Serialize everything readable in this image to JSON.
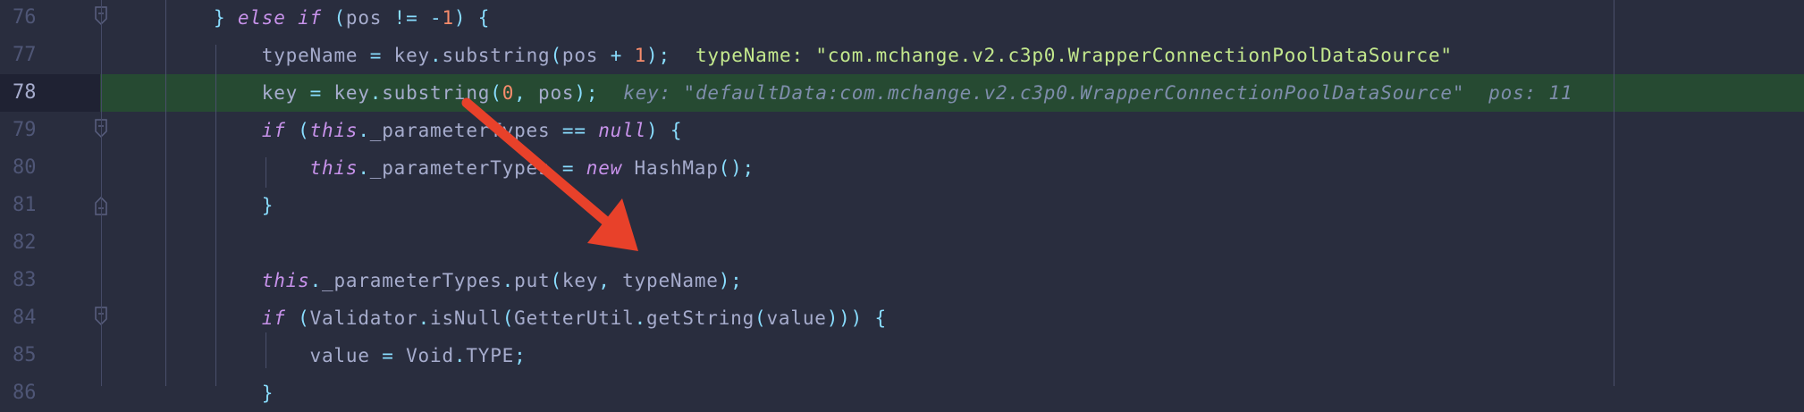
{
  "editor": {
    "theme_colors": {
      "background": "#292d3e",
      "current_line": "#264a32",
      "keyword": "#c792ea",
      "punctuation": "#89ddff",
      "number": "#f78c6c",
      "string": "#c3e88d",
      "text": "#a6accd",
      "annotation_arrow": "#e8412a"
    },
    "current_line": 78,
    "lines": [
      {
        "number": "76",
        "indent": "",
        "fold": "fold-open-icon",
        "tokens": [
          [
            "} ",
            "p"
          ],
          [
            "else if",
            "kw"
          ],
          [
            " (",
            "p"
          ],
          [
            "pos ",
            ""
          ],
          [
            "!= -",
            "p"
          ],
          [
            "1",
            "num"
          ],
          [
            ") {",
            "p"
          ]
        ]
      },
      {
        "number": "77",
        "indent": "    ",
        "tokens": [
          [
            "typeName ",
            ""
          ],
          [
            "= ",
            "p"
          ],
          [
            "key",
            ""
          ],
          [
            ".",
            "p"
          ],
          [
            "substring",
            ""
          ],
          [
            "(",
            "p"
          ],
          [
            "pos ",
            ""
          ],
          [
            "+ ",
            "p"
          ],
          [
            "1",
            "num"
          ],
          [
            ");",
            "p"
          ]
        ],
        "hint": "typeName: \"com.mchange.v2.c3p0.WrapperConnectionPoolDataSource\"",
        "hint_style": "str"
      },
      {
        "number": "78",
        "indent": "    ",
        "tokens": [
          [
            "key ",
            ""
          ],
          [
            "= ",
            "p"
          ],
          [
            "key",
            ""
          ],
          [
            ".",
            "p"
          ],
          [
            "substring",
            ""
          ],
          [
            "(",
            "p"
          ],
          [
            "0",
            "num"
          ],
          [
            ", ",
            "p"
          ],
          [
            "pos",
            ""
          ],
          [
            ");",
            "p"
          ]
        ],
        "hint": "key: \"defaultData:com.mchange.v2.c3p0.WrapperConnectionPoolDataSource\"  pos: 11",
        "hint_style": "gray"
      },
      {
        "number": "79",
        "indent": "    ",
        "fold": "fold-open-icon",
        "tokens": [
          [
            "if",
            "kw"
          ],
          [
            " (",
            "p"
          ],
          [
            "this",
            "this"
          ],
          [
            ".",
            "p"
          ],
          [
            "_parameterTypes ",
            ""
          ],
          [
            "== ",
            "p"
          ],
          [
            "null",
            "kw"
          ],
          [
            ") {",
            "p"
          ]
        ]
      },
      {
        "number": "80",
        "indent": "        ",
        "tokens": [
          [
            "this",
            "this"
          ],
          [
            ".",
            "p"
          ],
          [
            "_parameterTypes ",
            ""
          ],
          [
            "= ",
            "p"
          ],
          [
            "new",
            "kw"
          ],
          [
            " HashMap",
            ""
          ],
          [
            "();",
            "p"
          ]
        ]
      },
      {
        "number": "81",
        "indent": "    ",
        "fold": "fold-close-icon",
        "tokens": [
          [
            "}",
            "p"
          ]
        ]
      },
      {
        "number": "82",
        "indent": "",
        "tokens": []
      },
      {
        "number": "83",
        "indent": "    ",
        "tokens": [
          [
            "this",
            "this"
          ],
          [
            ".",
            "p"
          ],
          [
            "_parameterTypes",
            ""
          ],
          [
            ".",
            "p"
          ],
          [
            "put",
            ""
          ],
          [
            "(",
            "p"
          ],
          [
            "key",
            ""
          ],
          [
            ", ",
            "p"
          ],
          [
            "typeName",
            ""
          ],
          [
            ");",
            "p"
          ]
        ]
      },
      {
        "number": "84",
        "indent": "    ",
        "fold": "fold-open-icon",
        "tokens": [
          [
            "if",
            "kw"
          ],
          [
            " (",
            "p"
          ],
          [
            "Validator",
            ""
          ],
          [
            ".",
            "p"
          ],
          [
            "isNull",
            ""
          ],
          [
            "(",
            "p"
          ],
          [
            "GetterUtil",
            ""
          ],
          [
            ".",
            "p"
          ],
          [
            "getString",
            ""
          ],
          [
            "(",
            "p"
          ],
          [
            "value",
            ""
          ],
          [
            "))) {",
            "p"
          ]
        ]
      },
      {
        "number": "85",
        "indent": "        ",
        "tokens": [
          [
            "value ",
            ""
          ],
          [
            "= ",
            "p"
          ],
          [
            "Void",
            ""
          ],
          [
            ".",
            "p"
          ],
          [
            "TYPE",
            ""
          ],
          [
            ";",
            "p"
          ]
        ]
      },
      {
        "number": "86",
        "indent": "    ",
        "tokens": [
          [
            "}",
            "p"
          ]
        ]
      }
    ]
  }
}
